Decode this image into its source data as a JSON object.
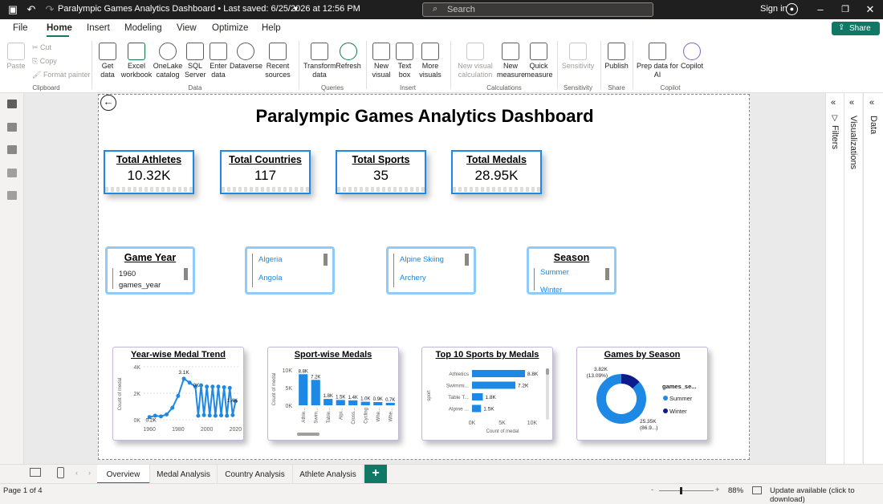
{
  "titlebar": {
    "doc_title": "Paralympic Games Analytics Dashboard • Last saved: 6/25/2026 at 12:56 PM",
    "search_placeholder": "Search",
    "signin": "Sign in"
  },
  "menu": {
    "items": [
      "File",
      "Home",
      "Insert",
      "Modeling",
      "View",
      "Optimize",
      "Help"
    ],
    "active": "Home",
    "share": "Share"
  },
  "ribbon": {
    "clipboard": {
      "paste": "Paste",
      "cut": "Cut",
      "copy": "Copy",
      "format_painter": "Format painter",
      "group": "Clipboard"
    },
    "data": {
      "get_data": "Get data",
      "excel": "Excel workbook",
      "onelake": "OneLake catalog",
      "sql": "SQL Server",
      "enter": "Enter data",
      "dataverse": "Dataverse",
      "recent": "Recent sources",
      "group": "Data"
    },
    "queries": {
      "transform": "Transform data",
      "refresh": "Refresh",
      "group": "Queries"
    },
    "insert": {
      "new_visual": "New visual",
      "text_box": "Text box",
      "more_visuals": "More visuals",
      "group": "Insert"
    },
    "calculations": {
      "new_visual_calc": "New visual calculation",
      "new_measure": "New measure",
      "quick_measure": "Quick measure",
      "group": "Calculations"
    },
    "sensitivity": {
      "label": "Sensitivity",
      "group": "Sensitivity"
    },
    "share": {
      "publish": "Publish",
      "group": "Share"
    },
    "copilot": {
      "prep": "Prep data for AI",
      "copilot": "Copilot",
      "group": "Copilot"
    }
  },
  "report": {
    "title": "Paralympic Games Analytics Dashboard",
    "kpis": [
      {
        "label": "Total Athletes",
        "value": "10.32K"
      },
      {
        "label": "Total Countries",
        "value": "117"
      },
      {
        "label": "Total Sports",
        "value": "35"
      },
      {
        "label": "Total Medals",
        "value": "28.95K"
      }
    ],
    "slicers": {
      "game_year": {
        "title": "Game Year",
        "item1": "1960",
        "item2": "games_year"
      },
      "country": {
        "item1": "Algeria",
        "item2": "Angola"
      },
      "sport": {
        "item1": "Alpine Skiing",
        "item2": "Archery"
      },
      "season": {
        "title": "Season",
        "item1": "Summer",
        "item2": "Winter"
      }
    }
  },
  "chart_data": [
    {
      "type": "line",
      "title": "Year-wise Medal Trend",
      "ylabel": "Count of medal",
      "x_ticks": [
        "1960",
        "1980",
        "2000",
        "2020"
      ],
      "y_ticks": [
        "0K",
        "2K",
        "4K"
      ],
      "ylim": [
        0,
        4000
      ],
      "x": [
        1960,
        1964,
        1968,
        1972,
        1976,
        1980,
        1984,
        1988,
        1992,
        1994,
        1996,
        1998,
        2000,
        2002,
        2004,
        2006,
        2008,
        2010,
        2012,
        2014,
        2016,
        2018,
        2020
      ],
      "values": [
        200,
        300,
        250,
        400,
        900,
        1800,
        3100,
        2800,
        2500,
        300,
        2600,
        350,
        2500,
        320,
        2500,
        300,
        2500,
        330,
        2450,
        300,
        2400,
        350,
        1400
      ],
      "labels": [
        {
          "text": "3.1K"
        },
        {
          "text": "0K"
        },
        {
          "text": "0.2K"
        },
        {
          "text": "1.4K"
        }
      ]
    },
    {
      "type": "bar",
      "title": "Sport-wise Medals",
      "ylabel": "Count of medal",
      "y_ticks": [
        "0K",
        "5K",
        "10K"
      ],
      "ylim": [
        0,
        10000
      ],
      "categories": [
        "Athle...",
        "Swim...",
        "Table...",
        "Alpi...",
        "Cross...",
        "Cycling",
        "Whe...",
        "Whe..."
      ],
      "values": [
        8800,
        7200,
        1800,
        1500,
        1400,
        1000,
        900,
        700
      ],
      "data_labels": [
        "8.8K",
        "7.2K",
        "1.8K",
        "1.5K",
        "1.4K",
        "1.0K",
        "0.9K",
        "0.7K"
      ]
    },
    {
      "type": "bar",
      "orientation": "horizontal",
      "title": "Top 10 Sports by Medals",
      "xlabel": "Count of medal",
      "ylabel": "sport",
      "x_ticks": [
        "0K",
        "5K",
        "10K"
      ],
      "xlim": [
        0,
        10000
      ],
      "categories": [
        "Athletics",
        "Swimmi...",
        "Table T...",
        "Alpine ..."
      ],
      "values": [
        8800,
        7200,
        1800,
        1500
      ],
      "data_labels": [
        "8.8K",
        "7.2K",
        "1.8K",
        "1.5K"
      ]
    },
    {
      "type": "pie",
      "title": "Games by Season",
      "legend_title": "games_se...",
      "slices": [
        {
          "name": "Summer",
          "value": 25350,
          "label": "25.35K",
          "pct_label": "(86.9...)",
          "color": "#1e88e5"
        },
        {
          "name": "Winter",
          "value": 3820,
          "label": "3.82K",
          "pct_label": "(13.09%)",
          "color": "#0d1b8c"
        }
      ]
    }
  ],
  "panes": {
    "filters": "Filters",
    "visualizations": "Visualizations",
    "data": "Data"
  },
  "pages": {
    "tabs": [
      "Overview",
      "Medal Analysis",
      "Country Analysis",
      "Athlete Analysis"
    ],
    "active": "Overview",
    "add": "+"
  },
  "status": {
    "page": "Page 1 of 4",
    "zoom": "88%",
    "update": "Update available (click to download)"
  },
  "colors": {
    "accent": "#117865",
    "bar": "#1e88e5",
    "kpi_border": "#1e88e5",
    "slicer_border": "#90caf9"
  }
}
